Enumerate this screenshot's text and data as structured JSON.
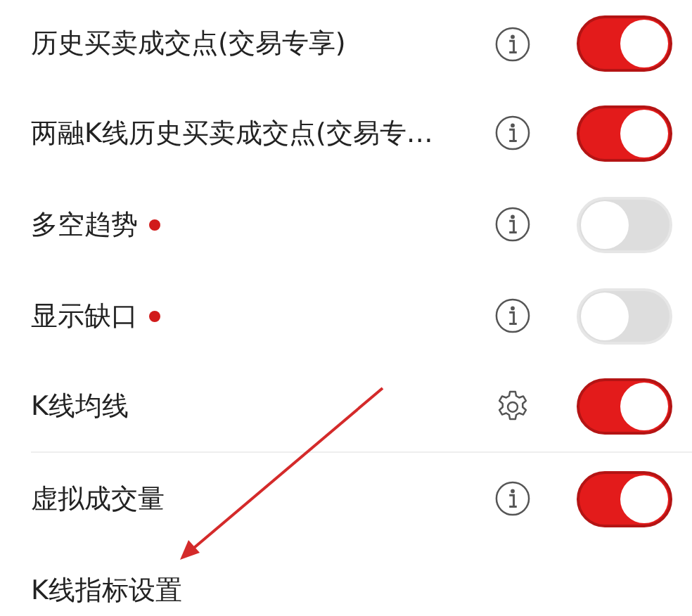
{
  "settings": [
    {
      "label": "历史买卖成交点(交易专享)",
      "kind": "info",
      "dot": false,
      "on": true
    },
    {
      "label": "两融K线历史买卖成交点(交易专…",
      "kind": "info",
      "dot": false,
      "on": true
    },
    {
      "label": "多空趋势",
      "kind": "info",
      "dot": true,
      "on": false
    },
    {
      "label": "显示缺口",
      "kind": "info",
      "dot": true,
      "on": false
    },
    {
      "label": "K线均线",
      "kind": "gear",
      "dot": false,
      "on": true
    },
    {
      "label": "虚拟成交量",
      "kind": "info",
      "dot": false,
      "on": true
    },
    {
      "label": "K线指标设置",
      "kind": "link"
    }
  ]
}
